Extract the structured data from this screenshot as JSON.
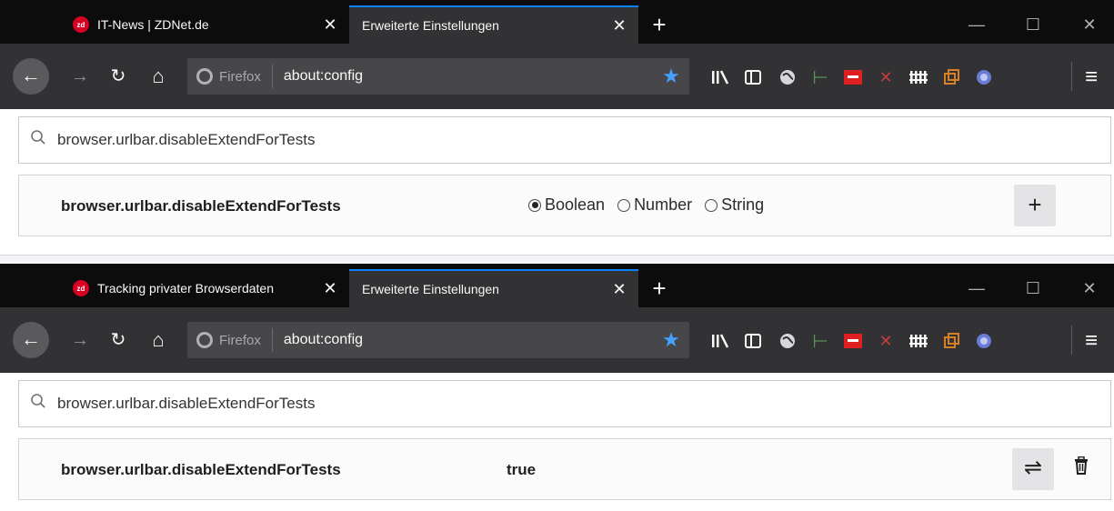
{
  "windows": [
    {
      "tabs": [
        {
          "label": "IT-News | ZDNet.de",
          "favicon": "zdnet-icon",
          "active": false
        },
        {
          "label": "Erweiterte Einstellungen",
          "active": true
        }
      ],
      "url": {
        "identity": "Firefox",
        "text": "about:config"
      },
      "search_value": "browser.urlbar.disableExtendForTests",
      "pref": {
        "name": "browser.urlbar.disableExtendForTests",
        "types": [
          "Boolean",
          "Number",
          "String"
        ],
        "selected_type": "Boolean",
        "add_label": "+"
      }
    },
    {
      "tabs": [
        {
          "label": "Tracking privater Browserdaten",
          "favicon": "zdnet-icon",
          "active": false
        },
        {
          "label": "Erweiterte Einstellungen",
          "active": true
        }
      ],
      "url": {
        "identity": "Firefox",
        "text": "about:config"
      },
      "search_value": "browser.urlbar.disableExtendForTests",
      "pref": {
        "name": "browser.urlbar.disableExtendForTests",
        "value": "true",
        "toggle_label": "⇌",
        "delete_label": "🗑"
      }
    }
  ],
  "icons": {
    "close": "✕",
    "new_tab": "+",
    "minimize": "—",
    "maximize": "☐",
    "window_close": "✕",
    "back": "←",
    "forward": "→",
    "reload": "↻",
    "home": "⌂",
    "star": "★",
    "search": "⚲",
    "menu": "≡"
  },
  "colors": {
    "tabbar_bg": "#0c0c0d",
    "navbar_bg": "#323234",
    "active_tab_accent": "#0a84ff",
    "star_blue": "#45a1ff",
    "favicon_red": "#d70022"
  }
}
